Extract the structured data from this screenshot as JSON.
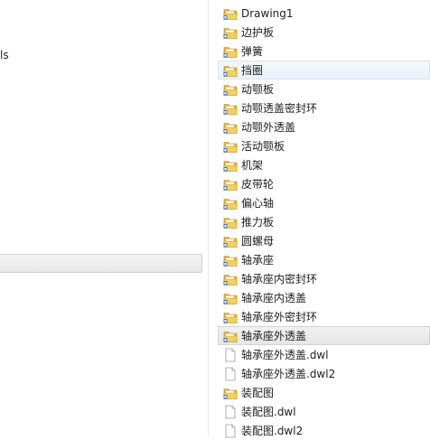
{
  "left_pane": {
    "nav_fragment": "ls"
  },
  "files": [
    {
      "name": "Drawing1",
      "type": "folder",
      "state": "normal"
    },
    {
      "name": "边护板",
      "type": "folder",
      "state": "normal"
    },
    {
      "name": "弹簧",
      "type": "folder",
      "state": "normal"
    },
    {
      "name": "挡圈",
      "type": "folder",
      "state": "hover"
    },
    {
      "name": "动颚板",
      "type": "folder",
      "state": "normal"
    },
    {
      "name": "动颚透盖密封环",
      "type": "folder",
      "state": "normal"
    },
    {
      "name": "动颚外透盖",
      "type": "folder",
      "state": "normal"
    },
    {
      "name": "活动颚板",
      "type": "folder",
      "state": "normal"
    },
    {
      "name": "机架",
      "type": "folder",
      "state": "normal"
    },
    {
      "name": "皮带轮",
      "type": "folder",
      "state": "normal"
    },
    {
      "name": "偏心轴",
      "type": "folder",
      "state": "normal"
    },
    {
      "name": "推力板",
      "type": "folder",
      "state": "normal"
    },
    {
      "name": "圆螺母",
      "type": "folder",
      "state": "normal"
    },
    {
      "name": "轴承座",
      "type": "folder",
      "state": "normal"
    },
    {
      "name": "轴承座内密封环",
      "type": "folder",
      "state": "normal"
    },
    {
      "name": "轴承座内透盖",
      "type": "folder",
      "state": "normal"
    },
    {
      "name": "轴承座外密封环",
      "type": "folder",
      "state": "normal"
    },
    {
      "name": "轴承座外透盖",
      "type": "folder",
      "state": "selected"
    },
    {
      "name": "轴承座外透盖.dwl",
      "type": "file",
      "state": "normal"
    },
    {
      "name": "轴承座外透盖.dwl2",
      "type": "file",
      "state": "normal"
    },
    {
      "name": "装配图",
      "type": "folder",
      "state": "normal"
    },
    {
      "name": "装配图.dwl",
      "type": "file",
      "state": "normal"
    },
    {
      "name": "装配图.dwl2",
      "type": "file",
      "state": "normal"
    }
  ],
  "colors": {
    "folder_back": "#e2b23a",
    "folder_front": "#f6cf5c",
    "folder_paper": "#ffffff",
    "badge_blue": "#3b6fb6",
    "hover_border": "#d7e4f2",
    "selected_border": "#d4d4d4"
  },
  "icons": {
    "folder": "folder-icon",
    "file": "file-icon"
  }
}
